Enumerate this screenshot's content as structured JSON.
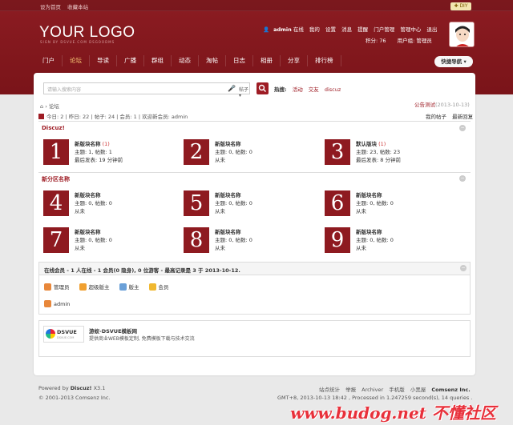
{
  "topbar": {
    "set_home": "设为首页",
    "bookmark": "收藏本站",
    "diy": "DIY"
  },
  "logo": {
    "text": "YOUR LOGO",
    "sub": "SIGN BY DSVUE.COM DSGOODMS"
  },
  "user": {
    "name": "admin",
    "status": "在线",
    "mine": "我的",
    "settings": "设置",
    "messages": "消息",
    "remind": "提醒",
    "portal_admin": "门户管理",
    "admin_center": "管理中心",
    "logout": "退出",
    "points": "积分: 76",
    "group": "用户组: 管理员"
  },
  "nav": [
    "门户",
    "论坛",
    "导读",
    "广播",
    "群组",
    "动态",
    "淘帖",
    "日志",
    "相册",
    "分享",
    "排行榜"
  ],
  "quicknav": "快捷导航",
  "search": {
    "placeholder": "请输入搜索内容",
    "type": "帖子",
    "hot_label": "热搜:",
    "hot": [
      "活动",
      "交友",
      "discuz"
    ]
  },
  "breadcrumb": "论坛",
  "announce": {
    "text": "公告测试",
    "date": "(2013-10-13)"
  },
  "stats": "今日: 2 | 昨日: 22 | 帖子: 24 | 会员: 1 | 欢迎新会员: admin",
  "mylinks": [
    "我的帖子",
    "最新回复"
  ],
  "sections": [
    {
      "title": "Discuz!",
      "forums": [
        {
          "num": "1",
          "name": "新版块名称",
          "new": "(1)",
          "line2": "主题: 1, 帖数: 1",
          "line3": "最后发表: 19 分钟前"
        },
        {
          "num": "2",
          "name": "新版块名称",
          "new": "",
          "line2": "主题: 0, 帖数: 0",
          "line3": "从未"
        },
        {
          "num": "3",
          "name": "默认版块",
          "new": "(1)",
          "line2": "主题: 23, 帖数: 23",
          "line3": "最后发表: 8 分钟前"
        }
      ]
    },
    {
      "title": "新分区名称",
      "forums": [
        {
          "num": "4",
          "name": "新版块名称",
          "new": "",
          "line2": "主题: 0, 帖数: 0",
          "line3": "从未"
        },
        {
          "num": "5",
          "name": "新版块名称",
          "new": "",
          "line2": "主题: 0, 帖数: 0",
          "line3": "从未"
        },
        {
          "num": "6",
          "name": "新版块名称",
          "new": "",
          "line2": "主题: 0, 帖数: 0",
          "line3": "从未"
        },
        {
          "num": "7",
          "name": "新版块名称",
          "new": "",
          "line2": "主题: 0, 帖数: 0",
          "line3": "从未"
        },
        {
          "num": "8",
          "name": "新版块名称",
          "new": "",
          "line2": "主题: 0, 帖数: 0",
          "line3": "从未"
        },
        {
          "num": "9",
          "name": "新版块名称",
          "new": "",
          "line2": "主题: 0, 帖数: 0",
          "line3": "从未"
        }
      ]
    }
  ],
  "online": {
    "title": "在线会员 - 1 人在线 - 1 会员(0 隐身), 0 位游客 - 最高记录是 3 于 2013-10-12.",
    "legend": [
      {
        "label": "管理员",
        "color": "#e8873a"
      },
      {
        "label": "超级版主",
        "color": "#f0a030"
      },
      {
        "label": "版主",
        "color": "#6aa0d8"
      },
      {
        "label": "会员",
        "color": "#f0b830"
      }
    ],
    "member": "admin"
  },
  "links": {
    "logo_text": "DSVUE",
    "logo_sub": "DSVUE.COM",
    "title": "游蚁-DSVUE模板网",
    "desc": "提供商业WEB模板定制, 免费模板下载与技术交流"
  },
  "footer": {
    "powered": "Powered by",
    "brand": "Discuz!",
    "version": "X3.1",
    "copyright": "© 2001-2013 Comsenz Inc.",
    "links": [
      "站点统计",
      "举报",
      "Archiver",
      "手机版",
      "小黑屋"
    ],
    "company": "Comsenz Inc.",
    "gmt": "GMT+8, 2013-10-13 18:42 , Processed in 1.247259 second(s), 14 queries ."
  },
  "watermark": "www.budog.net 不懂社区"
}
